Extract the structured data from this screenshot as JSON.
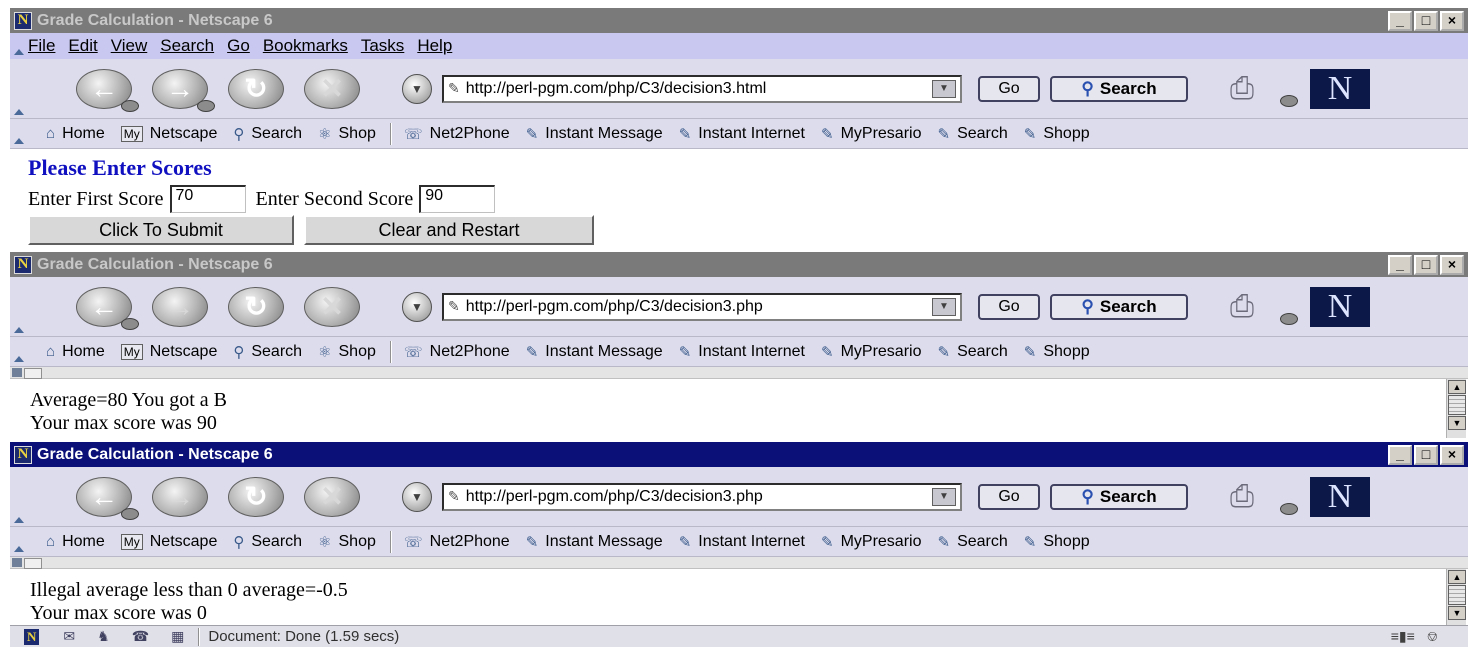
{
  "window_title": "Grade Calculation - Netscape 6",
  "window_controls": [
    "_",
    "□",
    "×"
  ],
  "menu": [
    "File",
    "Edit",
    "View",
    "Search",
    "Go",
    "Bookmarks",
    "Tasks",
    "Help"
  ],
  "nav": {
    "go_label": "Go",
    "search_label": "Search",
    "logo_letter": "N"
  },
  "personal_toolbar": {
    "items": [
      "Home",
      "Netscape",
      "Search",
      "Shop",
      "Net2Phone",
      "Instant Message",
      "Instant Internet",
      "MyPresario",
      "Search",
      "Shopp"
    ],
    "my_badge": "My"
  },
  "windows": [
    {
      "url": "http://perl-pgm.com/php/C3/decision3.html",
      "form": {
        "heading": "Please Enter Scores",
        "first_label": "Enter First Score",
        "first_value": "70",
        "second_label": "Enter Second Score",
        "second_value": "90",
        "submit_label": "Click To Submit",
        "clear_label": "Clear and Restart"
      }
    },
    {
      "url": "http://perl-pgm.com/php/C3/decision3.php",
      "lines": [
        "Average=80 You got a B",
        "Your max score was 90"
      ]
    },
    {
      "url": "http://perl-pgm.com/php/C3/decision3.php",
      "lines": [
        "Illegal average less than 0 average=-0.5",
        "Your max score was 0"
      ]
    }
  ],
  "status": {
    "text": "Document: Done (1.59 secs)",
    "n_badge": "N"
  },
  "colors": {
    "active_title": "#0a1078",
    "inactive_title": "#7a7a7a",
    "menu_bg": "#c8c8f0",
    "toolbar_bg": "#dcdcec",
    "heading": "#1010c0"
  }
}
